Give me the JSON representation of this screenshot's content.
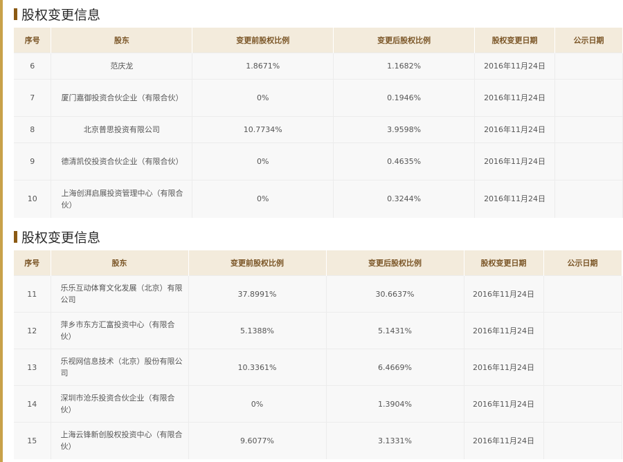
{
  "sections": [
    {
      "title": "股权变更信息",
      "headers": [
        "序号",
        "股东",
        "变更前股权比例",
        "变更后股权比例",
        "股权变更日期",
        "公示日期"
      ],
      "rows": [
        {
          "no": "6",
          "name": "范庆龙",
          "before": "1.8671%",
          "after": "1.1682%",
          "date": "2016年11月24日",
          "pub": ""
        },
        {
          "no": "7",
          "name": "厦门嘉御投资合伙企业（有限合伙）",
          "before": "0%",
          "after": "0.1946%",
          "date": "2016年11月24日",
          "pub": ""
        },
        {
          "no": "8",
          "name": "北京普思投资有限公司",
          "before": "10.7734%",
          "after": "3.9598%",
          "date": "2016年11月24日",
          "pub": ""
        },
        {
          "no": "9",
          "name": "德清凯佼投资合伙企业（有限合伙）",
          "before": "0%",
          "after": "0.4635%",
          "date": "2016年11月24日",
          "pub": ""
        },
        {
          "no": "10",
          "name": "上海创湃启展投资管理中心（有限合伙）",
          "before": "0%",
          "after": "0.3244%",
          "date": "2016年11月24日",
          "pub": ""
        }
      ]
    },
    {
      "title": "股权变更信息",
      "headers": [
        "序号",
        "股东",
        "变更前股权比例",
        "变更后股权比例",
        "股权变更日期",
        "公示日期"
      ],
      "rows": [
        {
          "no": "11",
          "name": "乐乐互动体育文化发展（北京）有限公司",
          "before": "37.8991%",
          "after": "30.6637%",
          "date": "2016年11月24日",
          "pub": ""
        },
        {
          "no": "12",
          "name": "萍乡市东方汇富投资中心（有限合伙）",
          "before": "5.1388%",
          "after": "5.1431%",
          "date": "2016年11月24日",
          "pub": ""
        },
        {
          "no": "13",
          "name": "乐视网信息技术（北京）股份有限公司",
          "before": "10.3361%",
          "after": "6.4669%",
          "date": "2016年11月24日",
          "pub": ""
        },
        {
          "no": "14",
          "name": "深圳市沧乐投资合伙企业（有限合伙）",
          "before": "0%",
          "after": "1.3904%",
          "date": "2016年11月24日",
          "pub": ""
        },
        {
          "no": "15",
          "name": "上海云锋新创股权投资中心（有限合伙）",
          "before": "9.6077%",
          "after": "3.1331%",
          "date": "2016年11月24日",
          "pub": ""
        }
      ]
    }
  ]
}
